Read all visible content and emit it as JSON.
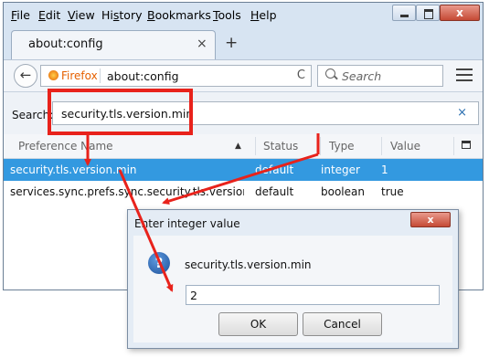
{
  "menu": [
    {
      "accel": "F",
      "rest": "ile"
    },
    {
      "accel": "E",
      "rest": "dit"
    },
    {
      "accel": "V",
      "rest": "iew"
    },
    {
      "pre": "Hi",
      "accel": "s",
      "rest": "tory"
    },
    {
      "accel": "B",
      "rest": "ookmarks"
    },
    {
      "accel": "T",
      "rest": "ools"
    },
    {
      "accel": "H",
      "rest": "elp"
    }
  ],
  "tab": {
    "title": "about:config",
    "close": "×",
    "new_tab": "+"
  },
  "nav": {
    "back": "←",
    "identity": "Firefox",
    "url": "about:config",
    "reload": "C",
    "search_placeholder": "Search"
  },
  "config": {
    "search_label": "Search:",
    "search_value": "security.tls.version.min",
    "clear": "×",
    "columns": [
      "Preference Name",
      "Status",
      "Type",
      "Value"
    ],
    "sort_indicator": "▲",
    "rows": [
      {
        "name": "security.tls.version.min",
        "status": "default",
        "type": "integer",
        "value": "1",
        "selected": true
      },
      {
        "name": "services.sync.prefs.sync.security.tls.version.min",
        "status": "default",
        "type": "boolean",
        "value": "true",
        "selected": false
      }
    ]
  },
  "dialog": {
    "title": "Enter integer value",
    "close": "x",
    "message": "security.tls.version.min",
    "input_value": "2",
    "ok": "OK",
    "cancel": "Cancel"
  },
  "colors": {
    "annotation_red": "#e8221b",
    "selection_blue": "#3399e0"
  }
}
